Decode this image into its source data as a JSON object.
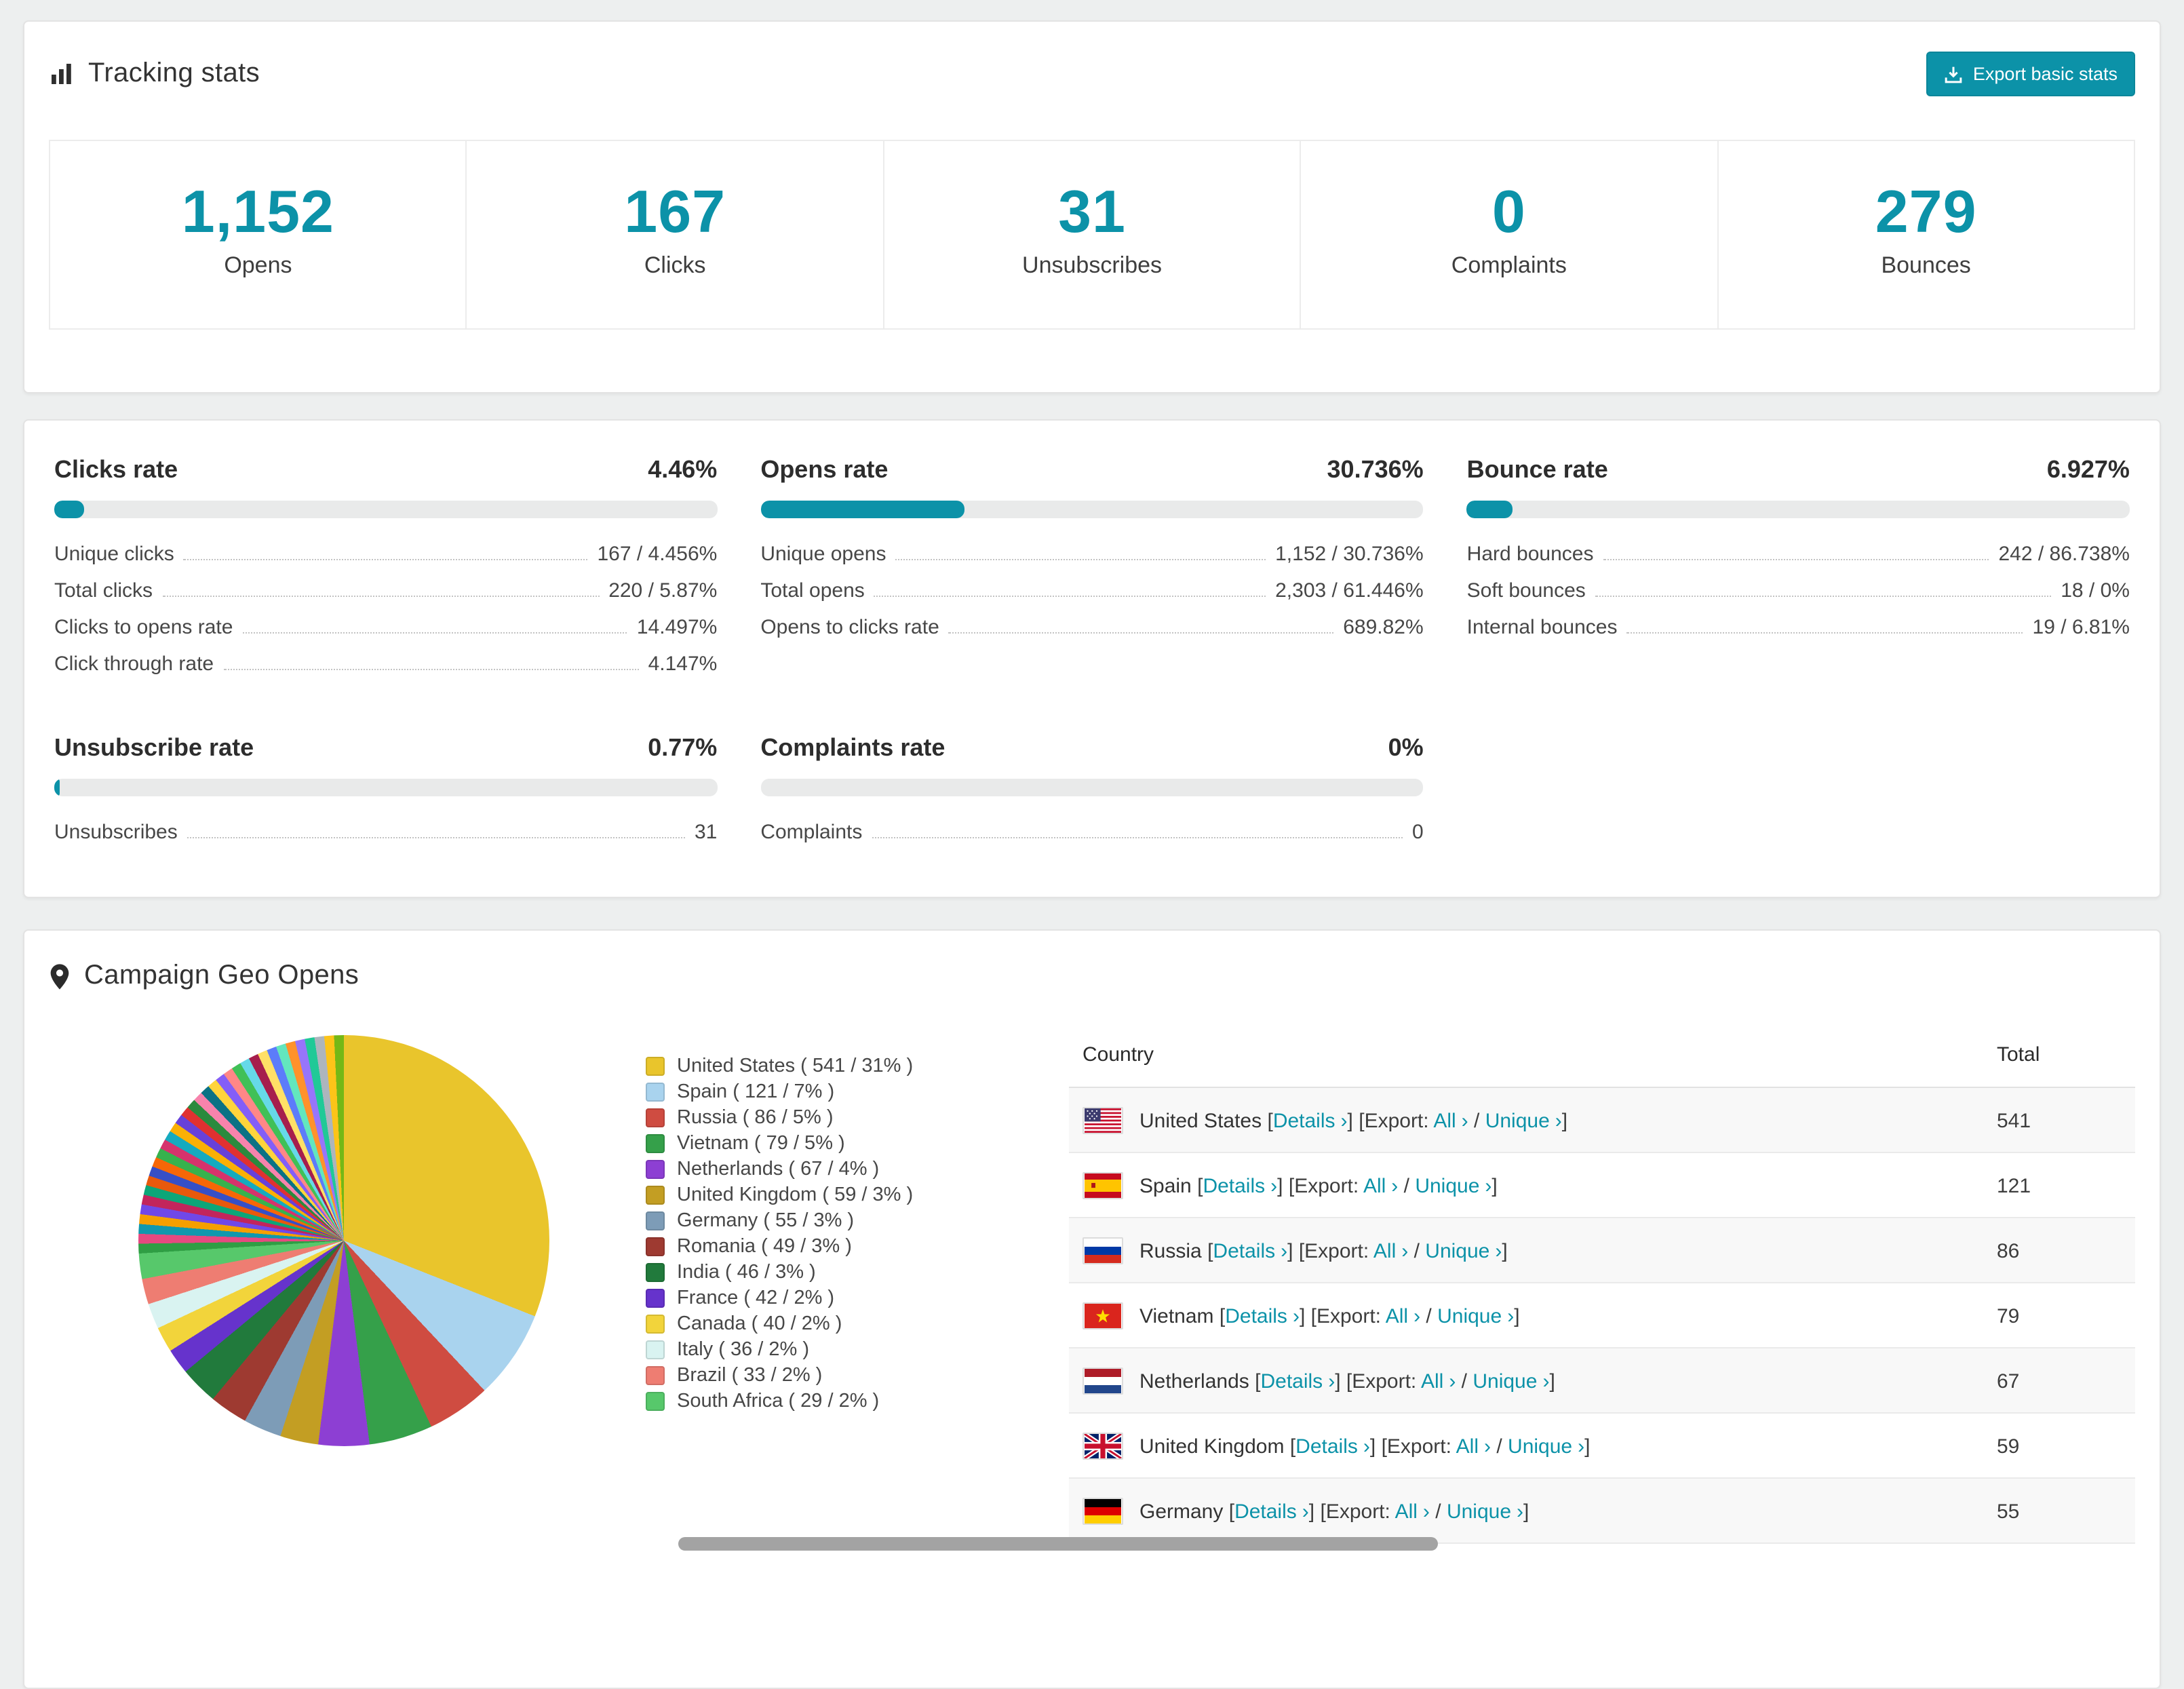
{
  "theme": {
    "accent": "#0c92a8",
    "bar_track": "#e9eaea"
  },
  "tracking": {
    "title": "Tracking stats",
    "export_button": "Export basic stats",
    "stats": [
      {
        "value": "1,152",
        "label": "Opens"
      },
      {
        "value": "167",
        "label": "Clicks"
      },
      {
        "value": "31",
        "label": "Unsubscribes"
      },
      {
        "value": "0",
        "label": "Complaints"
      },
      {
        "value": "279",
        "label": "Bounces"
      }
    ]
  },
  "rates": [
    {
      "title": "Clicks rate",
      "percent": "4.46%",
      "bar": 4.46,
      "rows": [
        {
          "label": "Unique clicks",
          "value": "167 / 4.456%"
        },
        {
          "label": "Total clicks",
          "value": "220 / 5.87%"
        },
        {
          "label": "Clicks to opens rate",
          "value": "14.497%"
        },
        {
          "label": "Click through rate",
          "value": "4.147%"
        }
      ]
    },
    {
      "title": "Opens rate",
      "percent": "30.736%",
      "bar": 30.736,
      "rows": [
        {
          "label": "Unique opens",
          "value": "1,152 / 30.736%"
        },
        {
          "label": "Total opens",
          "value": "2,303 / 61.446%"
        },
        {
          "label": "Opens to clicks rate",
          "value": "689.82%"
        }
      ]
    },
    {
      "title": "Bounce rate",
      "percent": "6.927%",
      "bar": 6.927,
      "rows": [
        {
          "label": "Hard bounces",
          "value": "242 / 86.738%"
        },
        {
          "label": "Soft bounces",
          "value": "18 / 0%"
        },
        {
          "label": "Internal bounces",
          "value": "19 / 6.81%"
        }
      ]
    },
    {
      "title": "Unsubscribe rate",
      "percent": "0.77%",
      "bar": 0.77,
      "rows": [
        {
          "label": "Unsubscribes",
          "value": "31"
        }
      ]
    },
    {
      "title": "Complaints rate",
      "percent": "0%",
      "bar": 0,
      "rows": [
        {
          "label": "Complaints",
          "value": "0"
        }
      ]
    }
  ],
  "geo": {
    "title": "Campaign Geo Opens",
    "table": {
      "col_country": "Country",
      "col_total": "Total",
      "bracket_open": "[",
      "bracket_close": "]",
      "link_details": "Details",
      "label_export": "Export:",
      "link_all": "All",
      "link_unique": "Unique",
      "slash": "/",
      "chevron": "›",
      "rows": [
        {
          "country": "United States",
          "total": "541",
          "flag": "us"
        },
        {
          "country": "Spain",
          "total": "121",
          "flag": "es"
        },
        {
          "country": "Russia",
          "total": "86",
          "flag": "ru"
        },
        {
          "country": "Vietnam",
          "total": "79",
          "flag": "vn"
        },
        {
          "country": "Netherlands",
          "total": "67",
          "flag": "nl"
        },
        {
          "country": "United Kingdom",
          "total": "59",
          "flag": "gb"
        },
        {
          "country": "Germany",
          "total": "55",
          "flag": "de"
        }
      ]
    }
  },
  "chart_data": {
    "type": "pie",
    "title": "Campaign Geo Opens",
    "unit": "opens",
    "legend_position": "right",
    "slices": [
      {
        "label": "United States",
        "value": 541,
        "percent": 31,
        "color": "#e9c52c"
      },
      {
        "label": "Spain",
        "value": 121,
        "percent": 7,
        "color": "#a9d3ee"
      },
      {
        "label": "Russia",
        "value": 86,
        "percent": 5,
        "color": "#cf4c41"
      },
      {
        "label": "Vietnam",
        "value": 79,
        "percent": 5,
        "color": "#35a04a"
      },
      {
        "label": "Netherlands",
        "value": 67,
        "percent": 4,
        "color": "#8d3fd3"
      },
      {
        "label": "United Kingdom",
        "value": 59,
        "percent": 3,
        "color": "#c39e23"
      },
      {
        "label": "Germany",
        "value": 55,
        "percent": 3,
        "color": "#7d9cb7"
      },
      {
        "label": "Romania",
        "value": 49,
        "percent": 3,
        "color": "#9e3a31"
      },
      {
        "label": "India",
        "value": 46,
        "percent": 3,
        "color": "#217a3c"
      },
      {
        "label": "France",
        "value": 42,
        "percent": 2,
        "color": "#6633cc"
      },
      {
        "label": "Canada",
        "value": 40,
        "percent": 2,
        "color": "#f2d43b"
      },
      {
        "label": "Italy",
        "value": 36,
        "percent": 2,
        "color": "#d9f3f1"
      },
      {
        "label": "Brazil",
        "value": 33,
        "percent": 2,
        "color": "#ee7d72"
      },
      {
        "label": "South Africa",
        "value": 29,
        "percent": 2,
        "color": "#57c86b"
      }
    ],
    "others": {
      "percent": 26,
      "colors": [
        "#2f9e44",
        "#e64980",
        "#1098ad",
        "#f59f00",
        "#7048e8",
        "#c2255c",
        "#0ca678",
        "#e8590c",
        "#364fc7",
        "#f76707",
        "#37b24d",
        "#d6336c",
        "#15aabf",
        "#fab005",
        "#6741d9",
        "#e03131",
        "#2b8a3e",
        "#f783ac",
        "#0b7285",
        "#ffd43b",
        "#845ef7",
        "#ff8787",
        "#40c057",
        "#66d9e8",
        "#a61e4d",
        "#ffe066",
        "#5c7cfa",
        "#63e6be",
        "#ff922b",
        "#9775fa",
        "#20c997",
        "#adb5bd",
        "#fcc419",
        "#74b816"
      ]
    }
  }
}
